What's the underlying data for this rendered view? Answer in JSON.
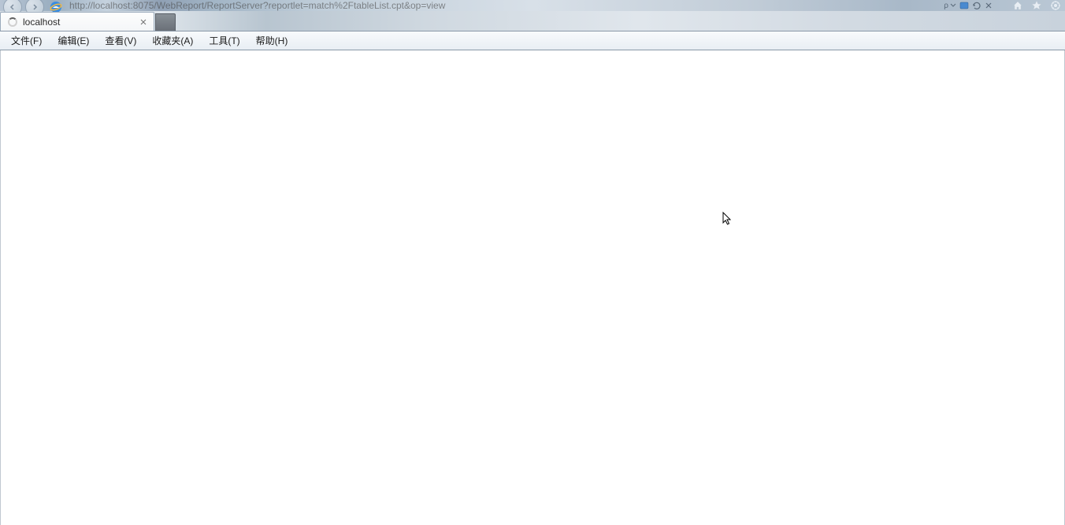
{
  "url": "http://localhost:8075/WebReport/ReportServer?reportlet=match%2FtableList.cpt&op=view",
  "tab": {
    "title": "localhost"
  },
  "menubar": {
    "items": [
      "文件(F)",
      "编辑(E)",
      "查看(V)",
      "收藏夹(A)",
      "工具(T)",
      "帮助(H)"
    ]
  },
  "search": {
    "indicator": "ρ"
  }
}
